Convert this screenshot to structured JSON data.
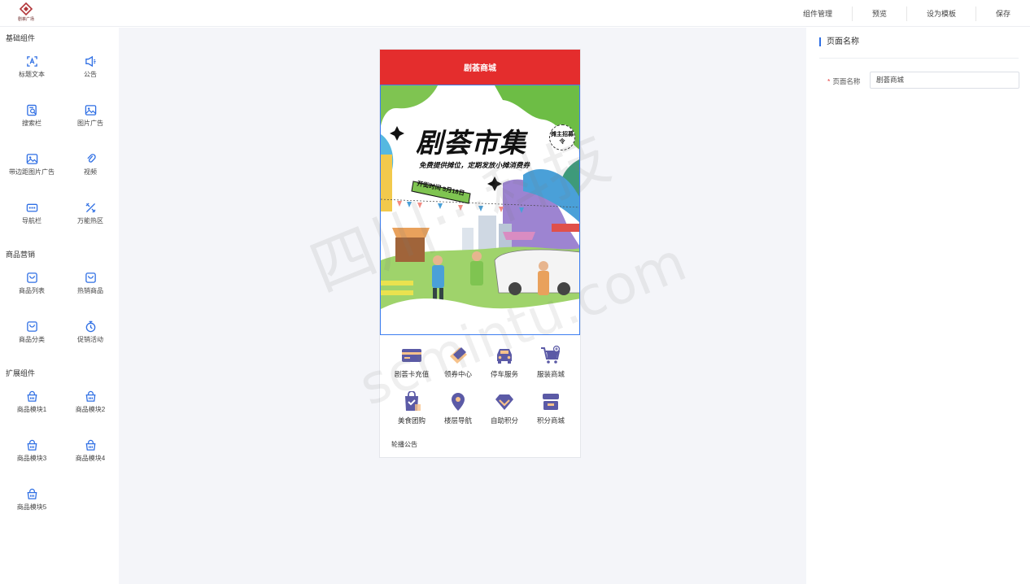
{
  "header": {
    "logo_text": "剧荟广场",
    "actions": [
      "组件管理",
      "预览",
      "设为模板",
      "保存"
    ]
  },
  "sidebar": {
    "sections": [
      {
        "title": "基础组件",
        "items": [
          {
            "label": "标题文本",
            "icon": "title-text-icon"
          },
          {
            "label": "公告",
            "icon": "announcement-icon"
          },
          {
            "label": "搜索栏",
            "icon": "search-bar-icon"
          },
          {
            "label": "图片广告",
            "icon": "image-ad-icon"
          },
          {
            "label": "带边距图片广告",
            "icon": "image-ad-margin-icon"
          },
          {
            "label": "视频",
            "icon": "video-icon"
          },
          {
            "label": "导航栏",
            "icon": "navbar-icon"
          },
          {
            "label": "万能热区",
            "icon": "hotzone-icon"
          }
        ]
      },
      {
        "title": "商品营销",
        "items": [
          {
            "label": "商品列表",
            "icon": "product-list-icon"
          },
          {
            "label": "热销商品",
            "icon": "hot-product-icon"
          },
          {
            "label": "商品分类",
            "icon": "product-category-icon"
          },
          {
            "label": "促销活动",
            "icon": "promotion-icon"
          }
        ]
      },
      {
        "title": "扩展组件",
        "items": [
          {
            "label": "商品模块1",
            "icon": "basket-icon"
          },
          {
            "label": "商品模块2",
            "icon": "basket-icon"
          },
          {
            "label": "商品模块3",
            "icon": "basket-icon"
          },
          {
            "label": "商品模块4",
            "icon": "basket-icon"
          },
          {
            "label": "商品模块5",
            "icon": "basket-icon"
          }
        ]
      }
    ]
  },
  "preview": {
    "page_title": "剧荟商城",
    "banner": {
      "title": "剧荟市集",
      "subtitle": "免费提供摊位，定期发放小摊消费券",
      "open_date": "开街时间 5月18日",
      "badge": "摊主招募令"
    },
    "nav_items": [
      {
        "label": "剧荟卡充值",
        "icon": "card-icon"
      },
      {
        "label": "领券中心",
        "icon": "coupon-icon"
      },
      {
        "label": "停车服务",
        "icon": "car-icon"
      },
      {
        "label": "服装商城",
        "icon": "cart-icon"
      },
      {
        "label": "美食团购",
        "icon": "food-bag-icon"
      },
      {
        "label": "楼层导航",
        "icon": "location-icon"
      },
      {
        "label": "自助积分",
        "icon": "points-icon"
      },
      {
        "label": "积分商城",
        "icon": "store-icon"
      }
    ],
    "notice_label": "轮播公告"
  },
  "settings": {
    "section_title": "页面名称",
    "field_label": "页面名称",
    "required_mark": "*",
    "field_value": "剧荟商城"
  },
  "watermark": {
    "line1": "四川···科技",
    "line2": "scmintu.com"
  },
  "colors": {
    "accent": "#2f6fe4",
    "header_red": "#e42d2d",
    "icon_purple": "#5b5aa6",
    "canvas_bg": "#f4f5f9"
  }
}
